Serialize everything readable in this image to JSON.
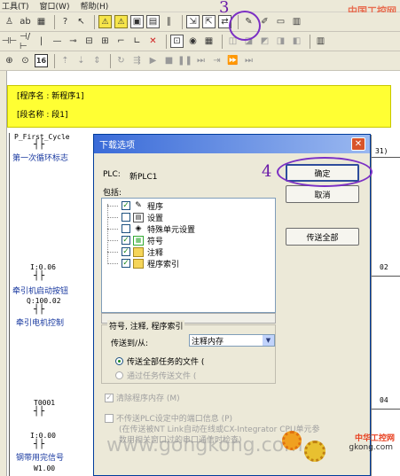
{
  "menu": [
    "工具(T)",
    "窗口(W)",
    "帮助(H)"
  ],
  "program": {
    "name_line": "[程序名 : 新程序1]",
    "section_line": "[段名称 : 段1]"
  },
  "ladder": {
    "labels": [
      "P_First_Cycle",
      "I:0.06",
      "Q:100.02",
      "T0001",
      "I:0.00",
      "W1.00"
    ],
    "comments": [
      "第一次循环标志",
      "牵引机启动按钮",
      "牵引电机控制",
      "钢带用完信号"
    ],
    "right_snippets": [
      "31)",
      "02",
      "04"
    ]
  },
  "dialog": {
    "title": "下载选项",
    "plc_label": "PLC:",
    "plc_name": "新PLC1",
    "include_label": "包括:",
    "tree": [
      {
        "label": "程序",
        "checked": true,
        "icon": "program-icon"
      },
      {
        "label": "设置",
        "checked": false,
        "icon": "settings-icon"
      },
      {
        "label": "特殊单元设置",
        "checked": false,
        "icon": "special-unit-icon"
      },
      {
        "label": "符号",
        "checked": true,
        "icon": "symbol-icon"
      },
      {
        "label": "注释",
        "checked": true,
        "icon": "comment-icon"
      },
      {
        "label": "程序索引",
        "checked": true,
        "icon": "folder-icon"
      }
    ],
    "ok_label": "确定",
    "cancel_label": "取消",
    "transfer_all_label": "传送全部",
    "group_title": "符号, 注释, 程序索引",
    "transfer_to_label": "传送到/从:",
    "transfer_to_value": "注释内存",
    "radio_all": "传送全部任务的文件 (",
    "radio_some": "通过任务传送文件 (",
    "clear_program_memory": "清除程序内存 (M)",
    "no_transfer_port": "不传送PLC设定中的端口信息 (P)",
    "note_line1": "(在传送被NT Link自动在线或CX-Integrator CPU单元参",
    "note_line2": "数用相关窗口过的串口通信时检查)"
  },
  "annotations": {
    "step3": "3",
    "step4": "4"
  },
  "watermark": {
    "site": "www.gongkong.com",
    "brand_cn": "中国工控网",
    "brand_cn2": "中华工控网",
    "brand_en": "gkong.com"
  },
  "colors": {
    "accent": "#3a6bd8",
    "annotation": "#7b2fc4",
    "highlight": "#ffff33",
    "comment": "#1a3aa0"
  }
}
